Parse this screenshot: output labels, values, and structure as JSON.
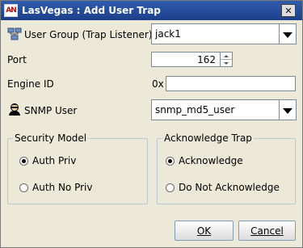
{
  "window": {
    "title": "LasVegas : Add User Trap",
    "app_icon_text": "AN",
    "close_symbol": "✕"
  },
  "form": {
    "user_group_label": "User Group (Trap Listener)",
    "user_group_value": "jack1",
    "port_label": "Port",
    "port_value": "162",
    "engine_id_label": "Engine ID",
    "engine_id_prefix": "0x",
    "engine_id_value": "",
    "snmp_user_label": "SNMP User",
    "snmp_user_value": "snmp_md5_user"
  },
  "security_model": {
    "title": "Security Model",
    "options": [
      {
        "label": "Auth Priv",
        "selected": true
      },
      {
        "label": "Auth No Priv",
        "selected": false
      }
    ]
  },
  "acknowledge_trap": {
    "title": "Acknowledge Trap",
    "options": [
      {
        "label": "Acknowledge",
        "selected": true
      },
      {
        "label": "Do Not Acknowledge",
        "selected": false
      }
    ]
  },
  "buttons": {
    "ok": "OK",
    "cancel": "Cancel"
  },
  "icons": {
    "app": "app-logo-icon",
    "user_group": "network-users-icon",
    "snmp_user": "user-agent-icon"
  },
  "colors": {
    "title_bar": "#1c3f8a",
    "dialog_bg": "#ece9d8"
  }
}
